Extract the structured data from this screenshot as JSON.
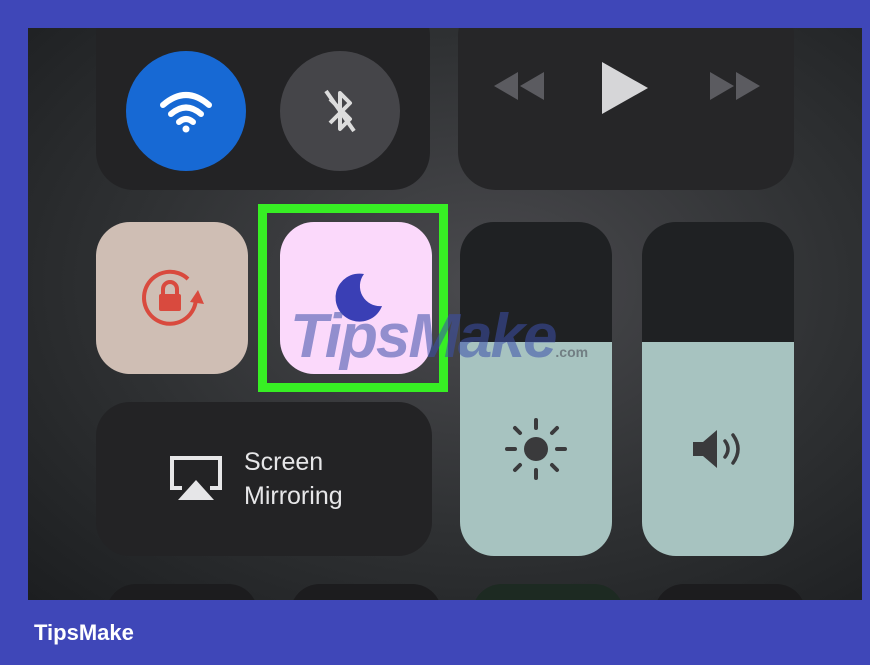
{
  "control_center": {
    "wifi": {
      "icon": "wifi-icon",
      "active": true,
      "color": "#1769d4"
    },
    "bluetooth": {
      "icon": "bluetooth-off-icon",
      "active": false
    },
    "media": {
      "previous_icon": "rewind-icon",
      "play_icon": "play-icon",
      "next_icon": "fast-forward-icon"
    },
    "rotation_lock": {
      "icon": "rotation-lock-icon",
      "color": "#d94a3e"
    },
    "do_not_disturb": {
      "icon": "moon-icon",
      "highlighted": true,
      "highlight_color": "#37ef24"
    },
    "brightness": {
      "icon": "sun-icon",
      "level": 0.64
    },
    "volume": {
      "icon": "speaker-icon",
      "level": 0.64
    },
    "screen_mirroring": {
      "icon": "airplay-icon",
      "label": "Screen\nMirroring"
    }
  },
  "watermark": {
    "main": "TipsMake",
    "suffix": ".com"
  },
  "footer": {
    "brand": "TipsMake"
  }
}
